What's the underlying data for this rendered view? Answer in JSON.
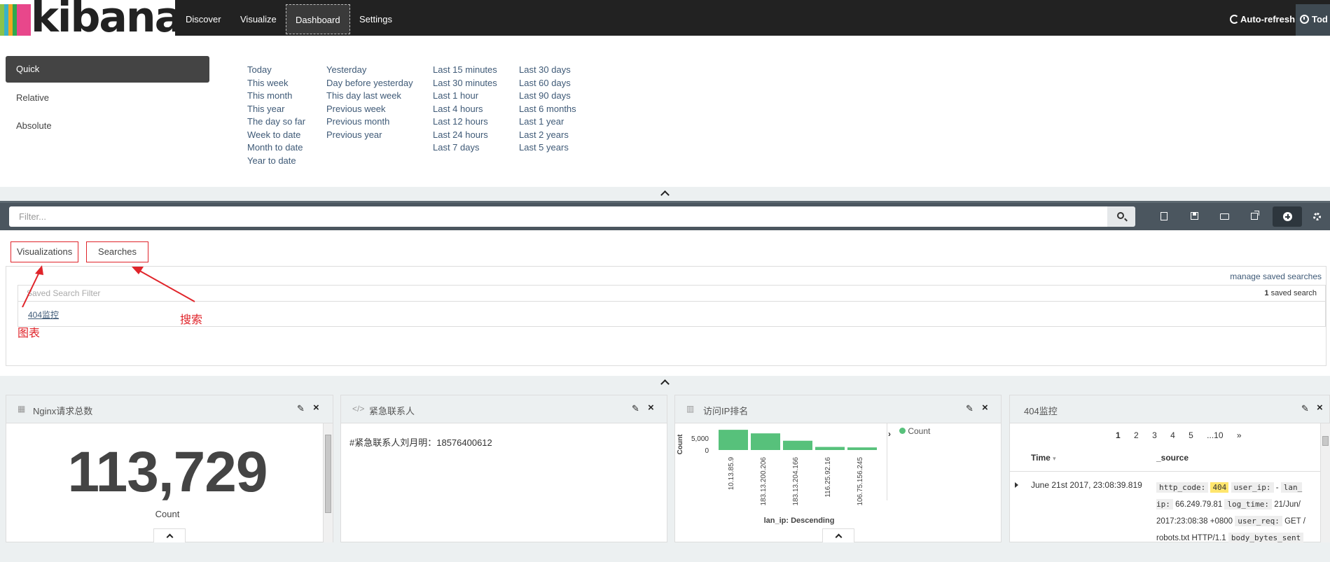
{
  "navbar": {
    "logo_text": "kibana",
    "logo_colors": [
      "#e8478b",
      "#3ab1c8",
      "#f0a720",
      "#2fa84f",
      "#8bc34a"
    ],
    "items": [
      {
        "label": "Discover"
      },
      {
        "label": "Visualize"
      },
      {
        "label": "Dashboard"
      },
      {
        "label": "Settings"
      }
    ],
    "auto_refresh": "Auto-refresh",
    "time_label": "Tod"
  },
  "timepicker": {
    "tabs": [
      "Quick",
      "Relative",
      "Absolute"
    ],
    "columns": [
      [
        "Today",
        "This week",
        "This month",
        "This year",
        "The day so far",
        "Week to date",
        "Month to date",
        "Year to date"
      ],
      [
        "Yesterday",
        "Day before yesterday",
        "This day last week",
        "Previous week",
        "Previous month",
        "Previous year"
      ],
      [
        "Last 15 minutes",
        "Last 30 minutes",
        "Last 1 hour",
        "Last 4 hours",
        "Last 12 hours",
        "Last 24 hours",
        "Last 7 days"
      ],
      [
        "Last 30 days",
        "Last 60 days",
        "Last 90 days",
        "Last 6 months",
        "Last 1 year",
        "Last 2 years",
        "Last 5 years"
      ]
    ]
  },
  "filter": {
    "placeholder": "Filter..."
  },
  "add_panel": {
    "tabs": [
      "Visualizations",
      "Searches"
    ],
    "manage_link": "manage saved searches",
    "saved_filter_placeholder": "Saved Search Filter",
    "saved_count_num": "1",
    "saved_count_text": "saved search",
    "items": [
      "404监控"
    ],
    "annotations": [
      "图表",
      "搜索"
    ]
  },
  "panels": {
    "metric": {
      "title": "Nginx请求总数",
      "value": "113,729",
      "label": "Count"
    },
    "markdown": {
      "title": "紧急联系人",
      "text": "#紧急联系人刘月明：18576400612"
    },
    "bar": {
      "title": "访问IP排名",
      "legend": "Count"
    },
    "search": {
      "title": "404监控",
      "pages": [
        "1",
        "2",
        "3",
        "4",
        "5",
        "...10",
        "»"
      ],
      "col_time": "Time",
      "col_source": "_source",
      "row_time": "June 21st 2017, 23:08:39.819",
      "source": [
        {
          "k": "http_code:",
          "v": "404",
          "hl": true
        },
        {
          "k": "user_ip:",
          "v": "-"
        },
        {
          "k": "lan_ ip:",
          "v": "66.249.79.81"
        },
        {
          "k": "log_time:",
          "v": "21/Jun/ 2017:23:08:38 +0800"
        },
        {
          "k": "user_req:",
          "v": "GET / robots.txt HTTP/1.1"
        },
        {
          "k": "body_bytes_sent",
          "v": ""
        }
      ]
    }
  },
  "chart_data": {
    "type": "bar",
    "categories": [
      "10.13.85.9",
      "183.13.200.206",
      "183.13.204.166",
      "116.25.92.16",
      "106.75.156.245"
    ],
    "values": [
      8500,
      7000,
      3900,
      1300,
      1100
    ],
    "ylabel": "Count",
    "xlabel": "lan_ip: Descending",
    "yticks": [
      "5,000",
      "0"
    ],
    "ylim": [
      0,
      10000
    ],
    "color": "#57c17b"
  }
}
